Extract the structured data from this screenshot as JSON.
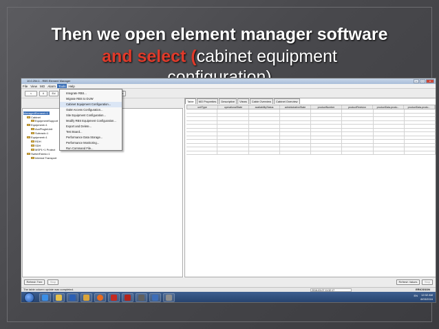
{
  "slide": {
    "title_line1": "Then we open element manager software",
    "title_line2_prefix": "and select (",
    "title_line2_em": "cabinet equipment",
    "title_line3": "configuration)"
  },
  "app": {
    "window_title": "10.0.254.1 - RBS Element Manager",
    "menu": [
      "File",
      "View",
      "MO",
      "Alarm",
      "Tools",
      "Help"
    ],
    "active_menu": "Tools",
    "tools_menu_items": [
      "Integrate RBS...",
      "Migrate RBS to DUW",
      "Cabinet Equipment Configuration...",
      "O&M Access Configuration...",
      "Site Equipment Configuration...",
      "Modify RBS Equipment Configuration...",
      "Export and Delete...",
      "Test Board...",
      "Performance Data Storage...",
      "Performance Monitoring...",
      "Run Command File..."
    ],
    "highlighted_item_index": 2,
    "toolbar_buttons": [
      "<",
      "∨",
      "Ed",
      "ix"
    ],
    "tree": [
      {
        "label": "ManagedElement=1",
        "indent": 0,
        "selected": true
      },
      {
        "label": "Cabinet",
        "indent": 1
      },
      {
        "label": "EquipmentSupport",
        "indent": 2
      },
      {
        "label": "Equipment=1",
        "indent": 1
      },
      {
        "label": "AuxPlugInUnit",
        "indent": 2
      },
      {
        "label": "Subrack=1",
        "indent": 2
      },
      {
        "label": "Equipment=1",
        "indent": 1
      },
      {
        "label": "RDH",
        "indent": 2
      },
      {
        "label": "SDH",
        "indent": 2
      },
      {
        "label": "MSP1+1 Protect",
        "indent": 2
      },
      {
        "label": "SwitchFabric=1",
        "indent": 1
      },
      {
        "label": "Internal Transport",
        "indent": 2
      }
    ],
    "tabs": [
      "Table",
      "MO Properties",
      "Descriptive",
      "Views",
      "Cable Overview",
      "Cabinet Overview"
    ],
    "active_tab": "Table",
    "columns": [
      "unitType",
      "operationalState",
      "availabilityStatus",
      "administrativeState",
      "productNumber",
      "productRevision",
      "productData.produ...",
      "productData.produ..."
    ],
    "bottom_left_buttons": [
      "Refresh Tree",
      "Stop"
    ],
    "bottom_right_buttons": [
      "Refresh Values",
      "Stop"
    ],
    "status_text": "The table column update was completed.",
    "status_datetime": "2016-03-07 11:32:17",
    "brand": "ERICSSON",
    "tray_lang": "EN",
    "clock_time": "12:32 AM",
    "clock_date": "8/03/2016"
  }
}
